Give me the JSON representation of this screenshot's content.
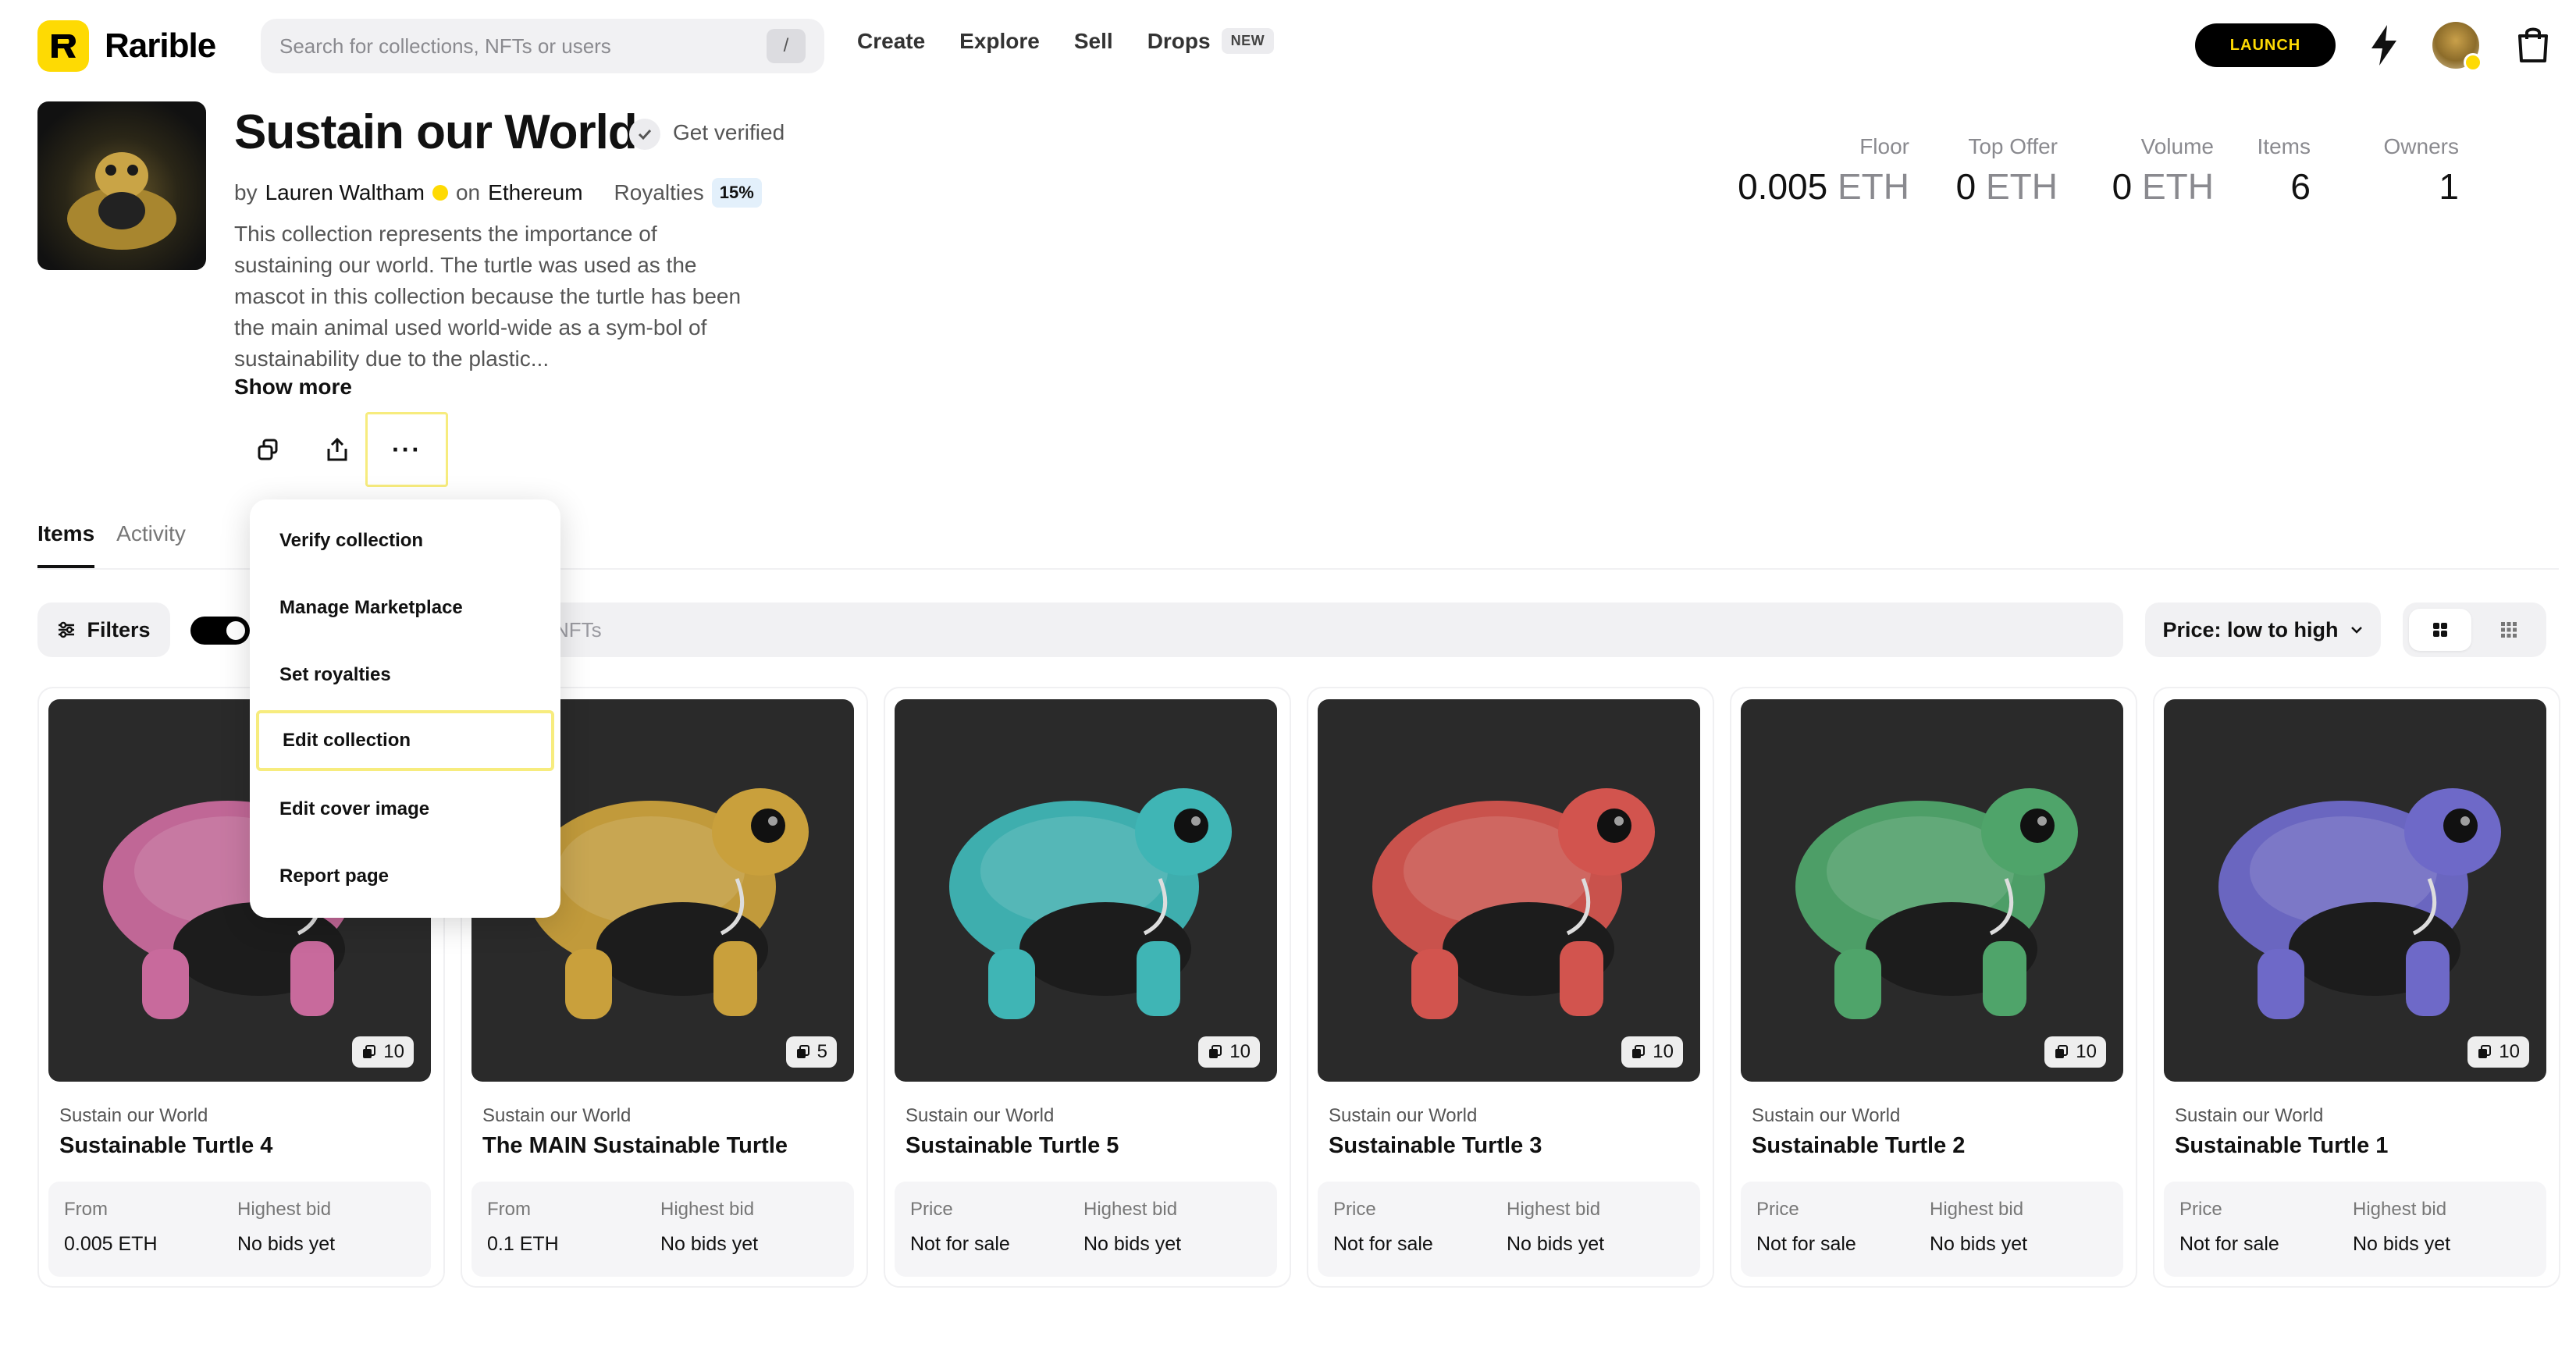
{
  "brand": {
    "name": "Rarible",
    "accent": "#FEDA03"
  },
  "search": {
    "placeholder": "Search for collections, NFTs or users",
    "shortcut": "/"
  },
  "nav": {
    "create": "Create",
    "explore": "Explore",
    "sell": "Sell",
    "drops": "Drops",
    "drops_badge": "NEW"
  },
  "header_actions": {
    "launch": "LAUNCH"
  },
  "collection": {
    "title": "Sustain our World",
    "get_verified": "Get verified",
    "by": "by",
    "creator": "Lauren Waltham",
    "on": "on",
    "chain": "Ethereum",
    "royalties_label": "Royalties",
    "royalties_value": "15%",
    "description": "This collection represents the importance of sustaining our world. The turtle was used as the mascot in this collection because the turtle has been the main animal used world-wide as a sym-bol of sustainability due to the plastic...",
    "show_more": "Show more",
    "more_button": "···"
  },
  "stats": [
    {
      "label": "Floor",
      "value": "0.005",
      "unit": "ETH"
    },
    {
      "label": "Top Offer",
      "value": "0",
      "unit": "ETH"
    },
    {
      "label": "Volume",
      "value": "0",
      "unit": "ETH"
    },
    {
      "label": "Items",
      "value": "6",
      "unit": ""
    },
    {
      "label": "Owners",
      "value": "1",
      "unit": ""
    }
  ],
  "tabs": {
    "items": "Items",
    "activity": "Activity"
  },
  "toolbar": {
    "filters": "Filters",
    "search_placeholder_partial": "NFTs",
    "sort": "Price: low to high"
  },
  "menu": {
    "items": [
      "Verify collection",
      "Manage Marketplace",
      "Set royalties",
      "Edit collection",
      "Edit cover image",
      "Report page"
    ],
    "highlighted": "Edit collection"
  },
  "cards": [
    {
      "collection": "Sustain our World",
      "name": "Sustainable Turtle 4",
      "copies": "10",
      "price_label": "From",
      "price": "0.005 ETH",
      "bid_label": "Highest bid",
      "bid": "No bids yet",
      "color": "#c86a9c"
    },
    {
      "collection": "Sustain our World",
      "name": "The MAIN Sustainable Turtle",
      "copies": "5",
      "price_label": "From",
      "price": "0.1 ETH",
      "bid_label": "Highest bid",
      "bid": "No bids yet",
      "color": "#c9a03c"
    },
    {
      "collection": "Sustain our World",
      "name": "Sustainable Turtle 5",
      "copies": "10",
      "price_label": "Price",
      "price": "Not for sale",
      "bid_label": "Highest bid",
      "bid": "No bids yet",
      "color": "#3fb5b5"
    },
    {
      "collection": "Sustain our World",
      "name": "Sustainable Turtle 3",
      "copies": "10",
      "price_label": "Price",
      "price": "Not for sale",
      "bid_label": "Highest bid",
      "bid": "No bids yet",
      "color": "#d2544e"
    },
    {
      "collection": "Sustain our World",
      "name": "Sustainable Turtle 2",
      "copies": "10",
      "price_label": "Price",
      "price": "Not for sale",
      "bid_label": "Highest bid",
      "bid": "No bids yet",
      "color": "#4fa46a"
    },
    {
      "collection": "Sustain our World",
      "name": "Sustainable Turtle 1",
      "copies": "10",
      "price_label": "Price",
      "price": "Not for sale",
      "bid_label": "Highest bid",
      "bid": "No bids yet",
      "color": "#6e69c8"
    }
  ]
}
